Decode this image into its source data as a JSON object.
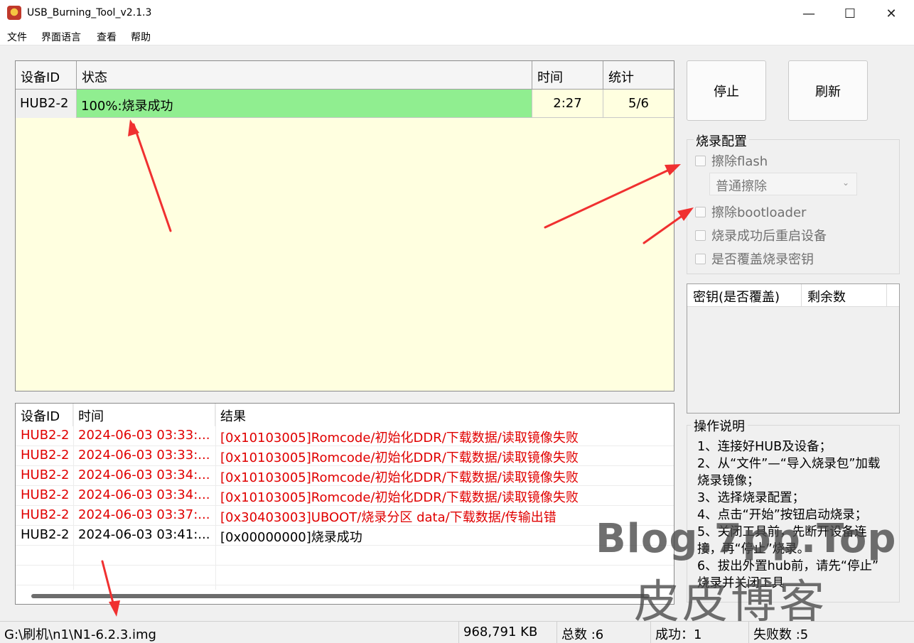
{
  "window": {
    "title": "USB_Burning_Tool_v2.1.3",
    "minimize_glyph": "—",
    "maximize_glyph": "☐",
    "close_glyph": "✕"
  },
  "menu": [
    "文件",
    "界面语言",
    "查看",
    "帮助"
  ],
  "device_table": {
    "headers": [
      "设备ID",
      "状态",
      "时间",
      "统计"
    ],
    "rows": [
      {
        "id": "HUB2-2",
        "status": "100%:烧录成功",
        "time": "2:27",
        "stats": "5/6"
      }
    ],
    "progress_fraction": 1.0,
    "progress_color": "#90ee90",
    "background_color": "#ffffe0"
  },
  "buttons": {
    "stop": "停止",
    "refresh": "刷新"
  },
  "config": {
    "legend": "烧录配置",
    "erase_flash": "擦除flash",
    "erase_mode": "普通擦除",
    "erase_bootloader": "擦除bootloader",
    "reboot_after": "烧录成功后重启设备",
    "overwrite_key": "是否覆盖烧录密钥"
  },
  "key_table": {
    "headers": [
      "密钥(是否覆盖)",
      "剩余数"
    ]
  },
  "instructions": {
    "legend": "操作说明",
    "lines": [
      "1、连接好HUB及设备；",
      "2、从“文件”—“导入烧录包”加载",
      "烧录镜像；",
      "3、选择烧录配置；",
      "4、点击“开始”按钮启动烧录；",
      "5、关闭工具前，先断开设备连",
      "接，再“停止”烧录。",
      "6、拔出外置hub前，请先“停止”",
      "烧录并关闭工具"
    ]
  },
  "log_table": {
    "headers": [
      "设备ID",
      "时间",
      "结果"
    ],
    "rows": [
      {
        "id": "HUB2-2",
        "time": "2024-06-03 03:33:...",
        "result": "[0x10103005]Romcode/初始化DDR/下载数据/读取镜像失败",
        "error": true
      },
      {
        "id": "HUB2-2",
        "time": "2024-06-03 03:33:...",
        "result": "[0x10103005]Romcode/初始化DDR/下载数据/读取镜像失败",
        "error": true
      },
      {
        "id": "HUB2-2",
        "time": "2024-06-03 03:34:...",
        "result": "[0x10103005]Romcode/初始化DDR/下载数据/读取镜像失败",
        "error": true
      },
      {
        "id": "HUB2-2",
        "time": "2024-06-03 03:34:...",
        "result": "[0x10103005]Romcode/初始化DDR/下载数据/读取镜像失败",
        "error": true
      },
      {
        "id": "HUB2-2",
        "time": "2024-06-03 03:37:...",
        "result": "[0x30403003]UBOOT/烧录分区 data/下载数据/传输出错",
        "error": true
      },
      {
        "id": "HUB2-2",
        "time": "2024-06-03 03:41:...",
        "result": "[0x00000000]烧录成功",
        "error": false
      }
    ],
    "error_color": "#e00000"
  },
  "status_bar": {
    "path": "G:\\刷机\\n1\\N1-6.2.3.img",
    "size": "968,791 KB",
    "total": "总数 :6",
    "success": "成功：1",
    "fail": "失败数 :5"
  },
  "watermark": {
    "line1": "Blog.7pp.Top",
    "line2": "皮皮博客"
  },
  "annotation_color": "#f03030"
}
